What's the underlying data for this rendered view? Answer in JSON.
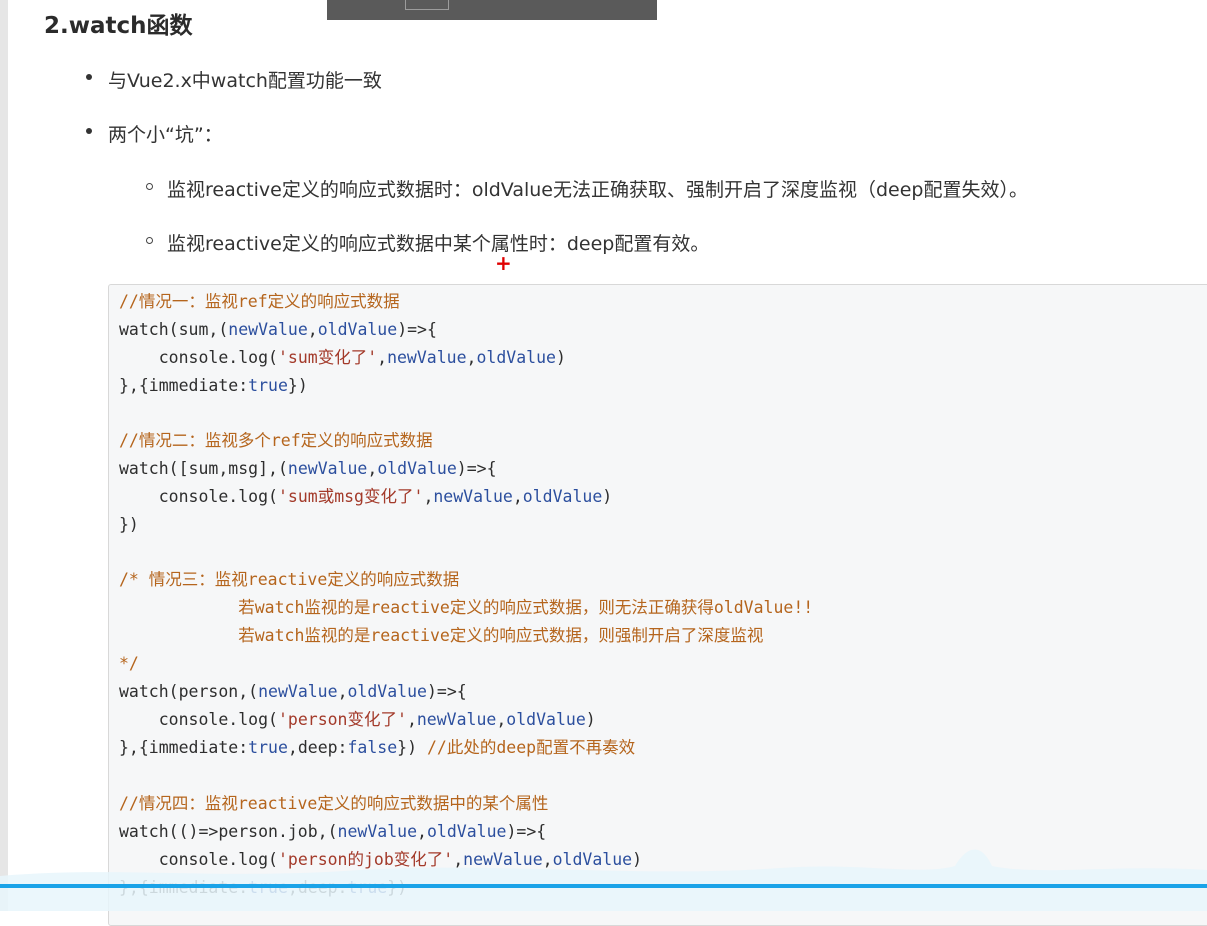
{
  "heading": "2.watch函数",
  "bullets": [
    "与Vue2.x中watch配置功能一致",
    "两个小“坑”："
  ],
  "sub_bullets": [
    "监视reactive定义的响应式数据时：oldValue无法正确获取、强制开启了深度监视（deep配置失效）。",
    "监视reactive定义的响应式数据中某个属性时：deep配置有效。"
  ],
  "cursor_glyph": "+",
  "code": {
    "l1": "//情况一：监视ref定义的响应式数据",
    "l2_a": "watch(sum,(",
    "l2_b": "newValue",
    "l2_c": ",",
    "l2_d": "oldValue",
    "l2_e": ")=>{",
    "l3_a": "    console.log(",
    "l3_b": "'sum变化了'",
    "l3_c": ",",
    "l3_d": "newValue",
    "l3_e": ",",
    "l3_f": "oldValue",
    "l3_g": ")",
    "l4_a": "},{immediate:",
    "l4_b": "true",
    "l4_c": "})",
    "l6": "//情况二：监视多个ref定义的响应式数据",
    "l7_a": "watch([sum,msg],(",
    "l7_b": "newValue",
    "l7_c": ",",
    "l7_d": "oldValue",
    "l7_e": ")=>{",
    "l8_a": "    console.log(",
    "l8_b": "'sum或msg变化了'",
    "l8_c": ",",
    "l8_d": "newValue",
    "l8_e": ",",
    "l8_f": "oldValue",
    "l8_g": ")",
    "l9": "})",
    "l11": "/* 情况三：监视reactive定义的响应式数据",
    "l12": "            若watch监视的是reactive定义的响应式数据，则无法正确获得oldValue!!",
    "l13": "            若watch监视的是reactive定义的响应式数据，则强制开启了深度监视",
    "l14": "*/",
    "l15_a": "watch(person,(",
    "l15_b": "newValue",
    "l15_c": ",",
    "l15_d": "oldValue",
    "l15_e": ")=>{",
    "l16_a": "    console.log(",
    "l16_b": "'person变化了'",
    "l16_c": ",",
    "l16_d": "newValue",
    "l16_e": ",",
    "l16_f": "oldValue",
    "l16_g": ")",
    "l17_a": "},{immediate:",
    "l17_b": "true",
    "l17_c": ",deep:",
    "l17_d": "false",
    "l17_e": "}) ",
    "l17_f": "//此处的deep配置不再奏效",
    "l19": "//情况四：监视reactive定义的响应式数据中的某个属性",
    "l20_a": "watch(()=>person.job,(",
    "l20_b": "newValue",
    "l20_c": ",",
    "l20_d": "oldValue",
    "l20_e": ")=>{",
    "l21_a": "    console.log(",
    "l21_b": "'person的job变化了'",
    "l21_c": ",",
    "l21_d": "newValue",
    "l21_e": ",",
    "l21_f": "oldValue",
    "l21_g": ")",
    "l22_a": "},{immediate:",
    "l22_b": "true",
    "l22_c": ",deep:",
    "l22_d": "true",
    "l22_e": "})"
  },
  "colors": {
    "comment": "#b5651d",
    "variable": "#2c4f9e",
    "string": "#a33a2a",
    "wave_accent": "#1aa3e8"
  }
}
